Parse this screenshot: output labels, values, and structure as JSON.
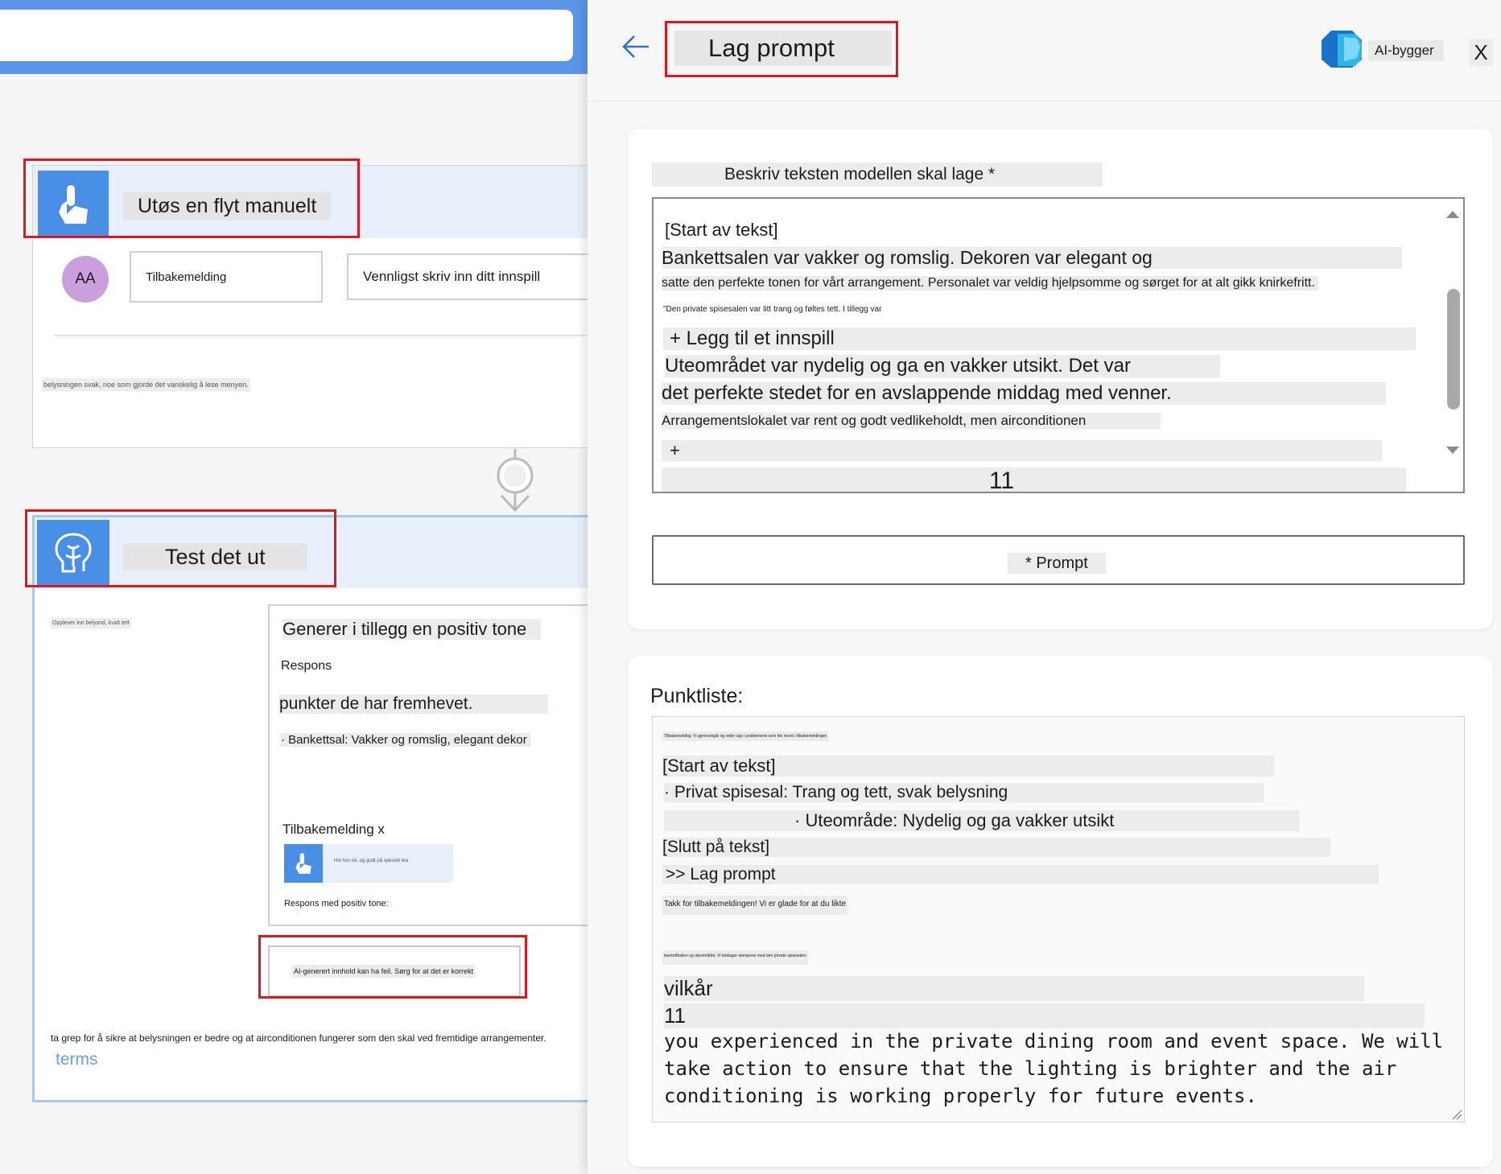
{
  "flow": {
    "trigger": {
      "title": "Utøs en flyt manuelt",
      "avatar": "AA",
      "field_label": "Tilbakemelding",
      "field_placeholder": "Vennligst skriv inn ditt innspill",
      "snippet": "belysningen svak, noe som gjorde det vanskelig å lese menyen."
    },
    "action": {
      "title": "Test det ut",
      "left_snippet": "Opplever inn belysnd, kvalt tett",
      "output_heading": "Generer i tillegg en positiv tone",
      "response_label": "Respons",
      "points_text": "punkter de har fremhevet.",
      "bullet": "· Bankettsal: Vakker og romslig, elegant dekor",
      "feedback_label": "Tilbakemelding x",
      "inner_text": "Hei hov ok, og godt på spesielt bra",
      "response_positive": "Respons med positiv tone:",
      "ai_notice": "AI-generert innhold kan ha feil. Sørg for at det er korrekt",
      "footer_text": "ta grep for å sikre at belysningen er bedre og at airconditionen fungerer som den skal ved fremtidige arrangementer.",
      "terms_link": "terms"
    }
  },
  "panel": {
    "title": "Lag prompt",
    "brand_label": "AI-bygger",
    "close_label": "X",
    "prompt_card": {
      "label": "Beskriv teksten modellen skal lage *",
      "lines": [
        "[Start av tekst]",
        "Bankettsalen var vakker og romslig. Dekoren var elegant og",
        "satte den perfekte tonen for vårt arrangement. Personalet var veldig hjelpsomme og sørget for at alt gikk knirkefritt.",
        "\"Den private spisesalen var litt trang og føltes tett. I tillegg var",
        "+ Legg til et innspill",
        "Uteområdet var nydelig og ga en vakker utsikt. Det var",
        "det perfekte stedet for en avslappende middag med venner.",
        "Arrangementslokalet var rent og godt vedlikeholdt, men airconditionen",
        "+",
        "11"
      ],
      "button_label": "* Prompt"
    },
    "result_card": {
      "label": "Punktliste:",
      "tiny_line": "Tilbakemelding: Vi gjennomgår og retter opp i problemene som ble nevnt i tilbakemeldingen",
      "lines": [
        "[Start av tekst]",
        "· Privat spisesal: Trang og tett, svak belysning",
        "· Uteområde: Nydelig og ga vakker utsikt",
        "[Slutt på tekst]",
        ">> Lag prompt"
      ],
      "thanks_line": "Takk for tilbakemeldingen! Vi er glade for at du likte",
      "tiny_line_2": "banketthallen og uteområdet. Vi beklager ulempene med den private spisesalen",
      "vilkar": "vilkår",
      "number": "11",
      "english": "you experienced in the private dining room and event space. We will\ntake action to ensure that the lighting is brighter and the air\nconditioning is working properly for future events."
    }
  },
  "colors": {
    "accent_blue": "#4a8fe6",
    "highlight_red": "#e0161e",
    "avatar_purple": "#c9a0dc",
    "link_blue": "#6aa0e8"
  }
}
